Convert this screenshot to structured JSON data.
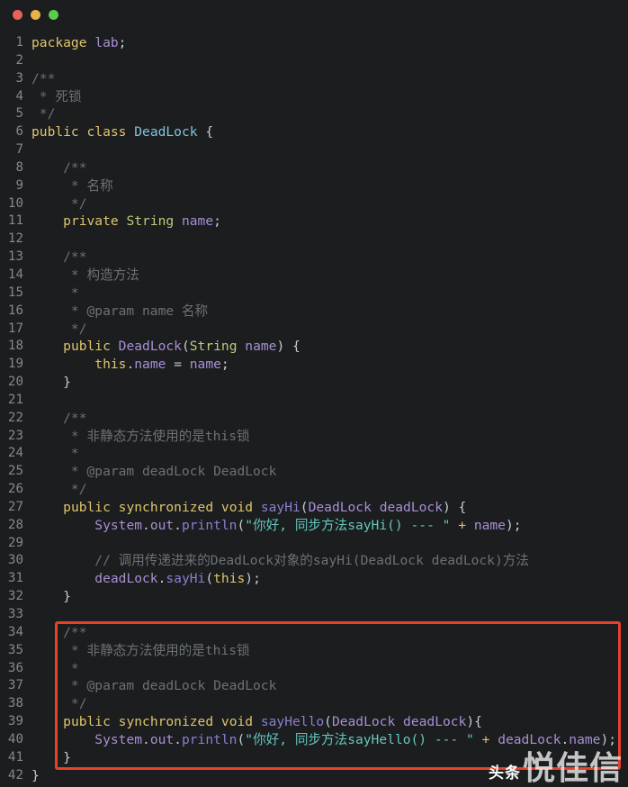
{
  "window": {
    "controls": [
      {
        "name": "close",
        "color": "#e8625c"
      },
      {
        "name": "minimize",
        "color": "#e6b44b"
      },
      {
        "name": "maximize",
        "color": "#5cc94f"
      }
    ]
  },
  "editor": {
    "language": "java",
    "background": "#1b1d1f",
    "gutter_color": "#808a8f",
    "highlight_box_color": "#e8412a",
    "highlight_box_lines": [
      34,
      41
    ],
    "lines": [
      {
        "n": "1",
        "tokens": [
          {
            "t": "package",
            "c": "kw"
          },
          {
            "t": " ",
            "c": "pun"
          },
          {
            "t": "lab",
            "c": "var"
          },
          {
            "t": ";",
            "c": "pun"
          }
        ]
      },
      {
        "n": "2",
        "tokens": []
      },
      {
        "n": "3",
        "tokens": [
          {
            "t": "/**",
            "c": "cmt"
          }
        ]
      },
      {
        "n": "4",
        "tokens": [
          {
            "t": " * 死锁",
            "c": "cmt"
          }
        ]
      },
      {
        "n": "5",
        "tokens": [
          {
            "t": " */",
            "c": "cmt"
          }
        ]
      },
      {
        "n": "6",
        "tokens": [
          {
            "t": "public",
            "c": "kw"
          },
          {
            "t": " ",
            "c": "pun"
          },
          {
            "t": "class",
            "c": "kw"
          },
          {
            "t": " ",
            "c": "pun"
          },
          {
            "t": "DeadLock",
            "c": "cls"
          },
          {
            "t": " {",
            "c": "pun"
          }
        ]
      },
      {
        "n": "7",
        "tokens": []
      },
      {
        "n": "8",
        "tokens": [
          {
            "t": "    /**",
            "c": "cmt"
          }
        ]
      },
      {
        "n": "9",
        "tokens": [
          {
            "t": "     * 名称",
            "c": "cmt"
          }
        ]
      },
      {
        "n": "10",
        "tokens": [
          {
            "t": "     */",
            "c": "cmt"
          }
        ]
      },
      {
        "n": "11",
        "tokens": [
          {
            "t": "    ",
            "c": "pun"
          },
          {
            "t": "private",
            "c": "kw"
          },
          {
            "t": " ",
            "c": "pun"
          },
          {
            "t": "String",
            "c": "typ"
          },
          {
            "t": " ",
            "c": "pun"
          },
          {
            "t": "name",
            "c": "var"
          },
          {
            "t": ";",
            "c": "pun"
          }
        ]
      },
      {
        "n": "12",
        "tokens": []
      },
      {
        "n": "13",
        "tokens": [
          {
            "t": "    /**",
            "c": "cmt"
          }
        ]
      },
      {
        "n": "14",
        "tokens": [
          {
            "t": "     * 构造方法",
            "c": "cmt"
          }
        ]
      },
      {
        "n": "15",
        "tokens": [
          {
            "t": "     *",
            "c": "cmt"
          }
        ]
      },
      {
        "n": "16",
        "tokens": [
          {
            "t": "     * @param name 名称",
            "c": "cmt"
          }
        ]
      },
      {
        "n": "17",
        "tokens": [
          {
            "t": "     */",
            "c": "cmt"
          }
        ]
      },
      {
        "n": "18",
        "tokens": [
          {
            "t": "    ",
            "c": "pun"
          },
          {
            "t": "public",
            "c": "kw"
          },
          {
            "t": " ",
            "c": "pun"
          },
          {
            "t": "DeadLock",
            "c": "var"
          },
          {
            "t": "(",
            "c": "pun"
          },
          {
            "t": "String",
            "c": "typ"
          },
          {
            "t": " ",
            "c": "pun"
          },
          {
            "t": "name",
            "c": "var"
          },
          {
            "t": ") {",
            "c": "pun"
          }
        ]
      },
      {
        "n": "19",
        "tokens": [
          {
            "t": "        ",
            "c": "pun"
          },
          {
            "t": "this",
            "c": "kw"
          },
          {
            "t": ".",
            "c": "pun"
          },
          {
            "t": "name",
            "c": "var"
          },
          {
            "t": " = ",
            "c": "pun"
          },
          {
            "t": "name",
            "c": "var"
          },
          {
            "t": ";",
            "c": "pun"
          }
        ]
      },
      {
        "n": "20",
        "tokens": [
          {
            "t": "    }",
            "c": "pun"
          }
        ]
      },
      {
        "n": "21",
        "tokens": []
      },
      {
        "n": "22",
        "tokens": [
          {
            "t": "    /**",
            "c": "cmt"
          }
        ]
      },
      {
        "n": "23",
        "tokens": [
          {
            "t": "     * 非静态方法使用的是this锁",
            "c": "cmt"
          }
        ]
      },
      {
        "n": "24",
        "tokens": [
          {
            "t": "     *",
            "c": "cmt"
          }
        ]
      },
      {
        "n": "25",
        "tokens": [
          {
            "t": "     * @param deadLock DeadLock",
            "c": "cmt"
          }
        ]
      },
      {
        "n": "26",
        "tokens": [
          {
            "t": "     */",
            "c": "cmt"
          }
        ]
      },
      {
        "n": "27",
        "tokens": [
          {
            "t": "    ",
            "c": "pun"
          },
          {
            "t": "public",
            "c": "kw"
          },
          {
            "t": " ",
            "c": "pun"
          },
          {
            "t": "synchronized",
            "c": "kw"
          },
          {
            "t": " ",
            "c": "pun"
          },
          {
            "t": "void",
            "c": "kw"
          },
          {
            "t": " ",
            "c": "pun"
          },
          {
            "t": "sayHi",
            "c": "fn"
          },
          {
            "t": "(",
            "c": "pun"
          },
          {
            "t": "DeadLock",
            "c": "var"
          },
          {
            "t": " ",
            "c": "pun"
          },
          {
            "t": "deadLock",
            "c": "var"
          },
          {
            "t": ") {",
            "c": "pun"
          }
        ]
      },
      {
        "n": "28",
        "tokens": [
          {
            "t": "        ",
            "c": "pun"
          },
          {
            "t": "System",
            "c": "var"
          },
          {
            "t": ".",
            "c": "pun"
          },
          {
            "t": "out",
            "c": "var"
          },
          {
            "t": ".",
            "c": "pun"
          },
          {
            "t": "println",
            "c": "fn"
          },
          {
            "t": "(",
            "c": "pun"
          },
          {
            "t": "\"你好, 同步方法sayHi() --- \"",
            "c": "str"
          },
          {
            "t": " ",
            "c": "pun"
          },
          {
            "t": "+",
            "c": "op"
          },
          {
            "t": " ",
            "c": "pun"
          },
          {
            "t": "name",
            "c": "var"
          },
          {
            "t": ");",
            "c": "pun"
          }
        ]
      },
      {
        "n": "29",
        "tokens": []
      },
      {
        "n": "30",
        "tokens": [
          {
            "t": "        // 调用传递进来的DeadLock对象的sayHi(DeadLock deadLock)方法",
            "c": "cmt"
          }
        ]
      },
      {
        "n": "31",
        "tokens": [
          {
            "t": "        ",
            "c": "pun"
          },
          {
            "t": "deadLock",
            "c": "var"
          },
          {
            "t": ".",
            "c": "pun"
          },
          {
            "t": "sayHi",
            "c": "fn"
          },
          {
            "t": "(",
            "c": "pun"
          },
          {
            "t": "this",
            "c": "kw"
          },
          {
            "t": ");",
            "c": "pun"
          }
        ]
      },
      {
        "n": "32",
        "tokens": [
          {
            "t": "    }",
            "c": "pun"
          }
        ]
      },
      {
        "n": "33",
        "tokens": []
      },
      {
        "n": "34",
        "tokens": [
          {
            "t": "    /**",
            "c": "cmt"
          }
        ]
      },
      {
        "n": "35",
        "tokens": [
          {
            "t": "     * 非静态方法使用的是this锁",
            "c": "cmt"
          }
        ]
      },
      {
        "n": "36",
        "tokens": [
          {
            "t": "     *",
            "c": "cmt"
          }
        ]
      },
      {
        "n": "37",
        "tokens": [
          {
            "t": "     * @param deadLock DeadLock",
            "c": "cmt"
          }
        ]
      },
      {
        "n": "38",
        "tokens": [
          {
            "t": "     */",
            "c": "cmt"
          }
        ]
      },
      {
        "n": "39",
        "tokens": [
          {
            "t": "    ",
            "c": "pun"
          },
          {
            "t": "public",
            "c": "kw"
          },
          {
            "t": " ",
            "c": "pun"
          },
          {
            "t": "synchronized",
            "c": "kw"
          },
          {
            "t": " ",
            "c": "pun"
          },
          {
            "t": "void",
            "c": "kw"
          },
          {
            "t": " ",
            "c": "pun"
          },
          {
            "t": "sayHello",
            "c": "fn"
          },
          {
            "t": "(",
            "c": "pun"
          },
          {
            "t": "DeadLock",
            "c": "var"
          },
          {
            "t": " ",
            "c": "pun"
          },
          {
            "t": "deadLock",
            "c": "var"
          },
          {
            "t": "){",
            "c": "pun"
          }
        ]
      },
      {
        "n": "40",
        "tokens": [
          {
            "t": "        ",
            "c": "pun"
          },
          {
            "t": "System",
            "c": "var"
          },
          {
            "t": ".",
            "c": "pun"
          },
          {
            "t": "out",
            "c": "var"
          },
          {
            "t": ".",
            "c": "pun"
          },
          {
            "t": "println",
            "c": "fn"
          },
          {
            "t": "(",
            "c": "pun"
          },
          {
            "t": "\"你好, 同步方法sayHello() --- \"",
            "c": "str"
          },
          {
            "t": " ",
            "c": "pun"
          },
          {
            "t": "+",
            "c": "op"
          },
          {
            "t": " ",
            "c": "pun"
          },
          {
            "t": "deadLock",
            "c": "var"
          },
          {
            "t": ".",
            "c": "pun"
          },
          {
            "t": "name",
            "c": "var"
          },
          {
            "t": ");",
            "c": "pun"
          }
        ]
      },
      {
        "n": "41",
        "tokens": [
          {
            "t": "    }",
            "c": "pun"
          }
        ]
      },
      {
        "n": "42",
        "tokens": [
          {
            "t": "}",
            "c": "pun"
          }
        ]
      }
    ]
  },
  "watermark": {
    "source": "头条",
    "author": "悦佳信"
  }
}
